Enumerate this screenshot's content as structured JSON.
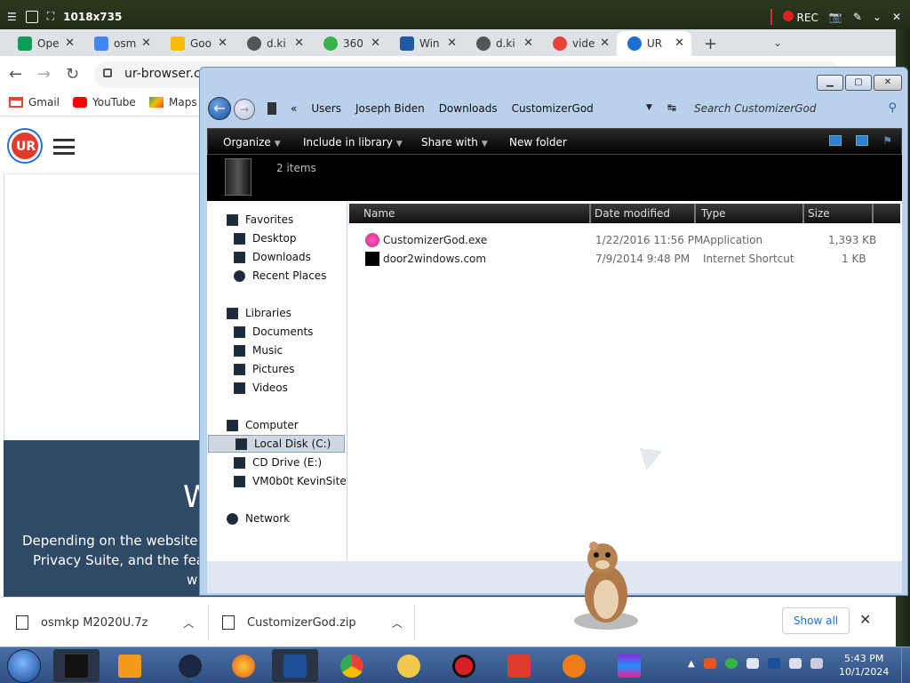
{
  "recorder": {
    "dimensions": "1018x735",
    "rec_label": "REC"
  },
  "tabs": [
    {
      "label": "Ope",
      "color": "#0f9d58"
    },
    {
      "label": "osm",
      "color": "#4285f4"
    },
    {
      "label": "Goo",
      "color": "#fbbc05"
    },
    {
      "label": "d.ki",
      "color": "#555555"
    },
    {
      "label": "360",
      "color": "#37b34a"
    },
    {
      "label": "Win",
      "color": "#1f5aa6"
    },
    {
      "label": "d.ki",
      "color": "#555555"
    },
    {
      "label": "vide",
      "color": "#ea4335"
    },
    {
      "label": "UR",
      "color": "#1d6fd6"
    }
  ],
  "toolbar": {
    "url": "ur-browser.co"
  },
  "bookmarks": [
    {
      "label": "Gmail",
      "color": "#ea4335"
    },
    {
      "label": "YouTube",
      "color": "#ff0000"
    },
    {
      "label": "Maps",
      "color": "#34a853"
    }
  ],
  "page": {
    "logo_text": "UR",
    "banner_big": "W",
    "banner_line1": "Depending on the website yo",
    "banner_line2": "Privacy Suite, and the featu",
    "banner_line3": "w"
  },
  "downloads": [
    {
      "name": "osmkp M2020U.7z"
    },
    {
      "name": "CustomizerGod.zip"
    }
  ],
  "downloads_bar": {
    "show_all": "Show all"
  },
  "explorer": {
    "breadcrumb": [
      "«",
      "Users",
      "Joseph Biden",
      "Downloads",
      "CustomizerGod"
    ],
    "search_placeholder": "Search CustomizerGod",
    "commands": [
      "Organize",
      "Include in library",
      "Share with",
      "New folder"
    ],
    "item_count": "2 items",
    "nav": {
      "favorites": "Favorites",
      "fav_items": [
        "Desktop",
        "Downloads",
        "Recent Places"
      ],
      "libraries": "Libraries",
      "lib_items": [
        "Documents",
        "Music",
        "Pictures",
        "Videos"
      ],
      "computer": "Computer",
      "comp_items": [
        "Local Disk (C:)",
        "CD Drive (E:)",
        "VM0b0t KevinSite"
      ],
      "network": "Network"
    },
    "columns": [
      "Name",
      "Date modified",
      "Type",
      "Size"
    ],
    "files": [
      {
        "name": "CustomizerGod.exe",
        "date": "1/22/2016 11:56 PM",
        "type": "Application",
        "size": "1,393 KB"
      },
      {
        "name": "door2windows.com",
        "date": "7/9/2014 9:48 PM",
        "type": "Internet Shortcut",
        "size": "1 KB"
      }
    ]
  },
  "taskbar": {
    "time": "5:43 PM",
    "date": "10/1/2024",
    "apps": [
      "explorer",
      "media-player",
      "browser-globe",
      "firefox",
      "remote-desktop",
      "chrome",
      "vpn",
      "recorder",
      "wps-office",
      "avast",
      "winrar"
    ]
  }
}
